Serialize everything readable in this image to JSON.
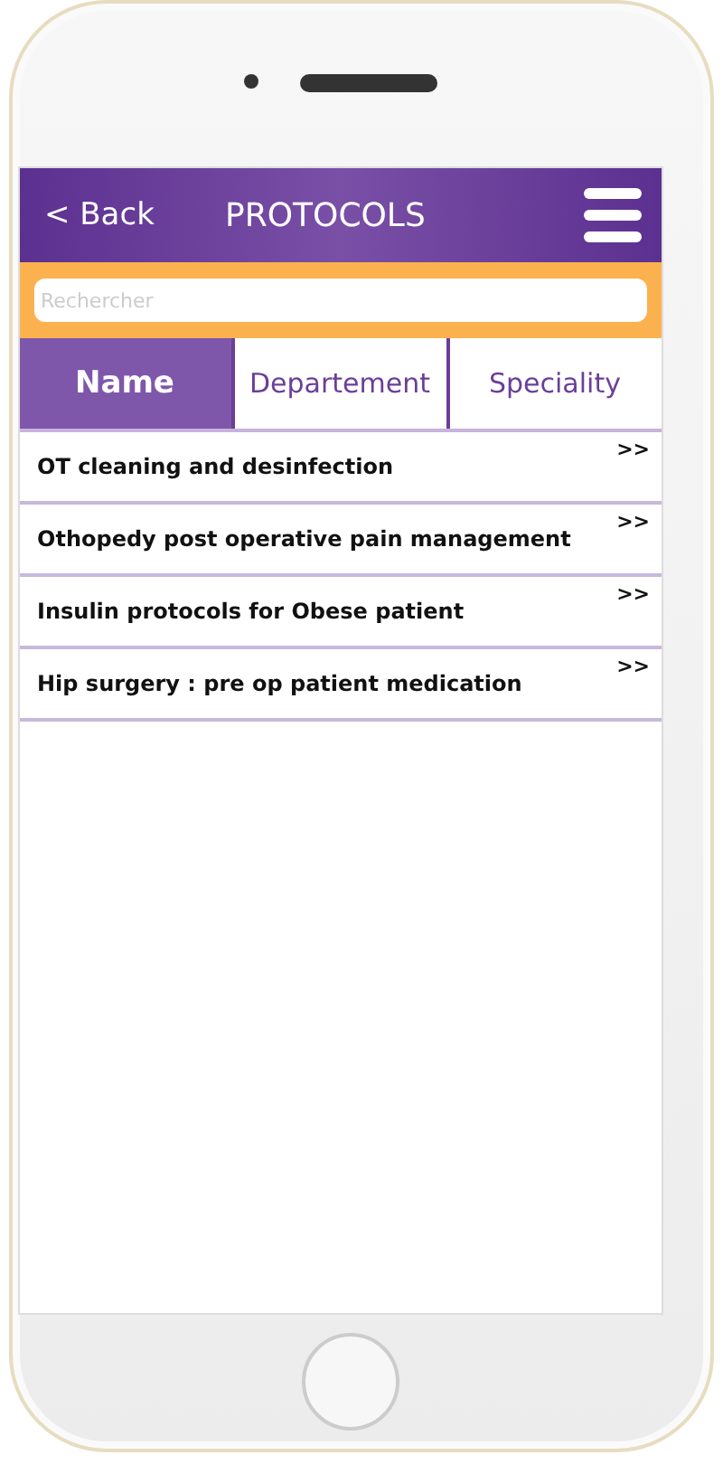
{
  "header": {
    "back": "< Back",
    "title": "PROTOCOLS"
  },
  "search": {
    "placeholder": "Rechercher"
  },
  "tabs": [
    {
      "label": "Name",
      "selected": true
    },
    {
      "label": "Departement",
      "selected": false
    },
    {
      "label": "Speciality",
      "selected": false
    }
  ],
  "protocols": [
    {
      "title": "OT cleaning and desinfection",
      "arrow": ">>"
    },
    {
      "title": "Othopedy post operative pain management",
      "arrow": ">>"
    },
    {
      "title": "Insulin protocols for Obese patient",
      "arrow": ">>"
    },
    {
      "title": "Hip surgery : pre op patient medication",
      "arrow": ">>"
    }
  ]
}
